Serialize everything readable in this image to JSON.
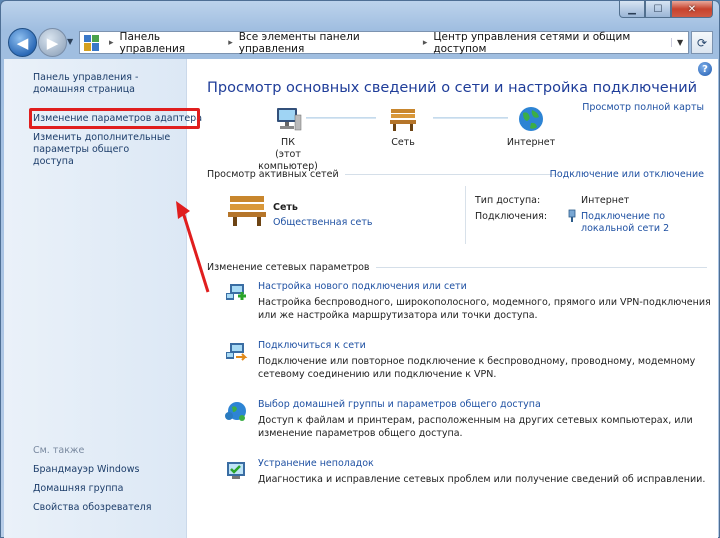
{
  "window": {
    "minimize_glyph": "▁",
    "maximize_glyph": "☐",
    "close_glyph": "✕"
  },
  "address_bar": {
    "breadcrumbs": [
      "Панель управления",
      "Все элементы панели управления",
      "Центр управления сетями и общим доступом"
    ],
    "separator": "▸"
  },
  "sidebar": {
    "home_link": "Панель управления - домашняя страница",
    "adapter_link": "Изменение параметров адаптера",
    "advanced_link": "Изменить дополнительные параметры общего доступа",
    "see_also_label": "См. также",
    "see_also": [
      "Брандмауэр Windows",
      "Домашняя группа",
      "Свойства обозревателя"
    ]
  },
  "main": {
    "title": "Просмотр основных сведений о сети и настройка подключений",
    "full_map_link": "Просмотр полной карты",
    "map": {
      "pc_label_line1": "ПК",
      "pc_label_line2": "(этот компьютер)",
      "network_label": "Сеть",
      "internet_label": "Интернет"
    },
    "active": {
      "header": "Просмотр активных сетей",
      "connect_link": "Подключение или отключение",
      "network_name": "Сеть",
      "network_type": "Общественная сеть",
      "access_type_label": "Тип доступа:",
      "access_type_value": "Интернет",
      "connections_label": "Подключения:",
      "connection_value": "Подключение по локальной сети 2"
    },
    "change": {
      "header": "Изменение сетевых параметров",
      "tasks": [
        {
          "title": "Настройка нового подключения или сети",
          "desc": "Настройка беспроводного, широкополосного, модемного, прямого или VPN-подключения или же настройка маршрутизатора или точки доступа."
        },
        {
          "title": "Подключиться к сети",
          "desc": "Подключение или повторное подключение к беспроводному, проводному, модемному сетевому соединению или подключение к VPN."
        },
        {
          "title": "Выбор домашней группы и параметров общего доступа",
          "desc": "Доступ к файлам и принтерам, расположенным на других сетевых компьютерах, или изменение параметров общего доступа."
        },
        {
          "title": "Устранение неполадок",
          "desc": "Диагностика и исправление сетевых проблем или получение сведений об исправлении."
        }
      ]
    }
  },
  "colors": {
    "link": "#1e50a2",
    "title": "#1f3d99",
    "highlight": "#e01e1e"
  }
}
